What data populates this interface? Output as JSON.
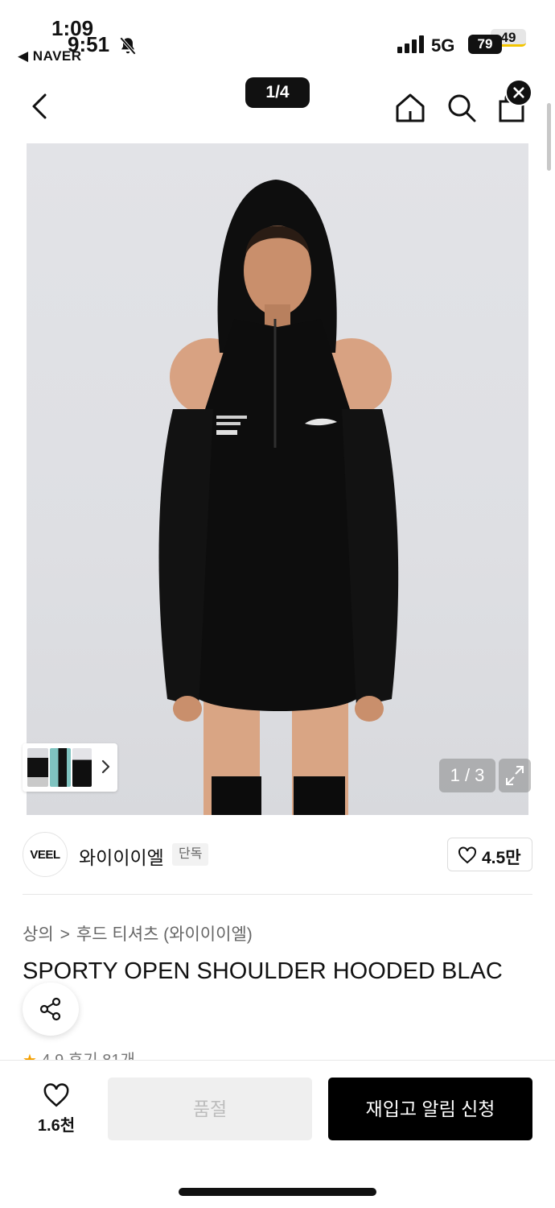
{
  "status_bar": {
    "time_primary": "1:09",
    "time_secondary": "9:51",
    "back_app": "◀ NAVER",
    "network": "5G",
    "battery_primary": "79",
    "battery_secondary": "49"
  },
  "header": {
    "image_pager": "1/4"
  },
  "gallery": {
    "counter": "1 / 3",
    "accent_colors": {
      "thumb2": "#7fc3c0"
    }
  },
  "brand": {
    "logo_text": "VEEL",
    "name": "와이이이엘",
    "tag": "단독",
    "likes": "4.5만"
  },
  "breadcrumb": {
    "level1": "상의",
    "level2": "후드 티셔츠 (와이이이엘)"
  },
  "product": {
    "title": "SPORTY OPEN SHOULDER HOODED BLAC",
    "rating": "4.9",
    "reviews": "후기 81개"
  },
  "bottom_bar": {
    "wish_count": "1.6천",
    "soldout_label": "품절",
    "restock_label": "재입고 알림 신청"
  },
  "icons": [
    "bell-mute-icon",
    "signal-icon",
    "back-icon",
    "home-icon",
    "search-icon",
    "cart-icon",
    "close-icon",
    "chevron-right-icon",
    "expand-icon",
    "heart-icon",
    "share-icon",
    "star-icon"
  ]
}
